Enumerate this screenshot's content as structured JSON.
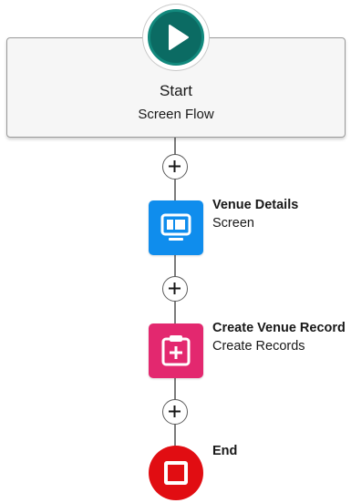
{
  "start": {
    "title": "Start",
    "subtitle": "Screen Flow",
    "icon": "play-icon",
    "color": "#0b6b63"
  },
  "nodes": [
    {
      "label": "Venue Details",
      "type": "Screen",
      "icon": "screen-icon",
      "color": "#0f8ded"
    },
    {
      "label": "Create Venue Record",
      "type": "Create Records",
      "icon": "create-records-icon",
      "color": "#e3286f"
    }
  ],
  "end": {
    "label": "End",
    "icon": "stop-icon",
    "color": "#e10d12"
  },
  "add_button": {
    "icon": "plus-icon"
  }
}
